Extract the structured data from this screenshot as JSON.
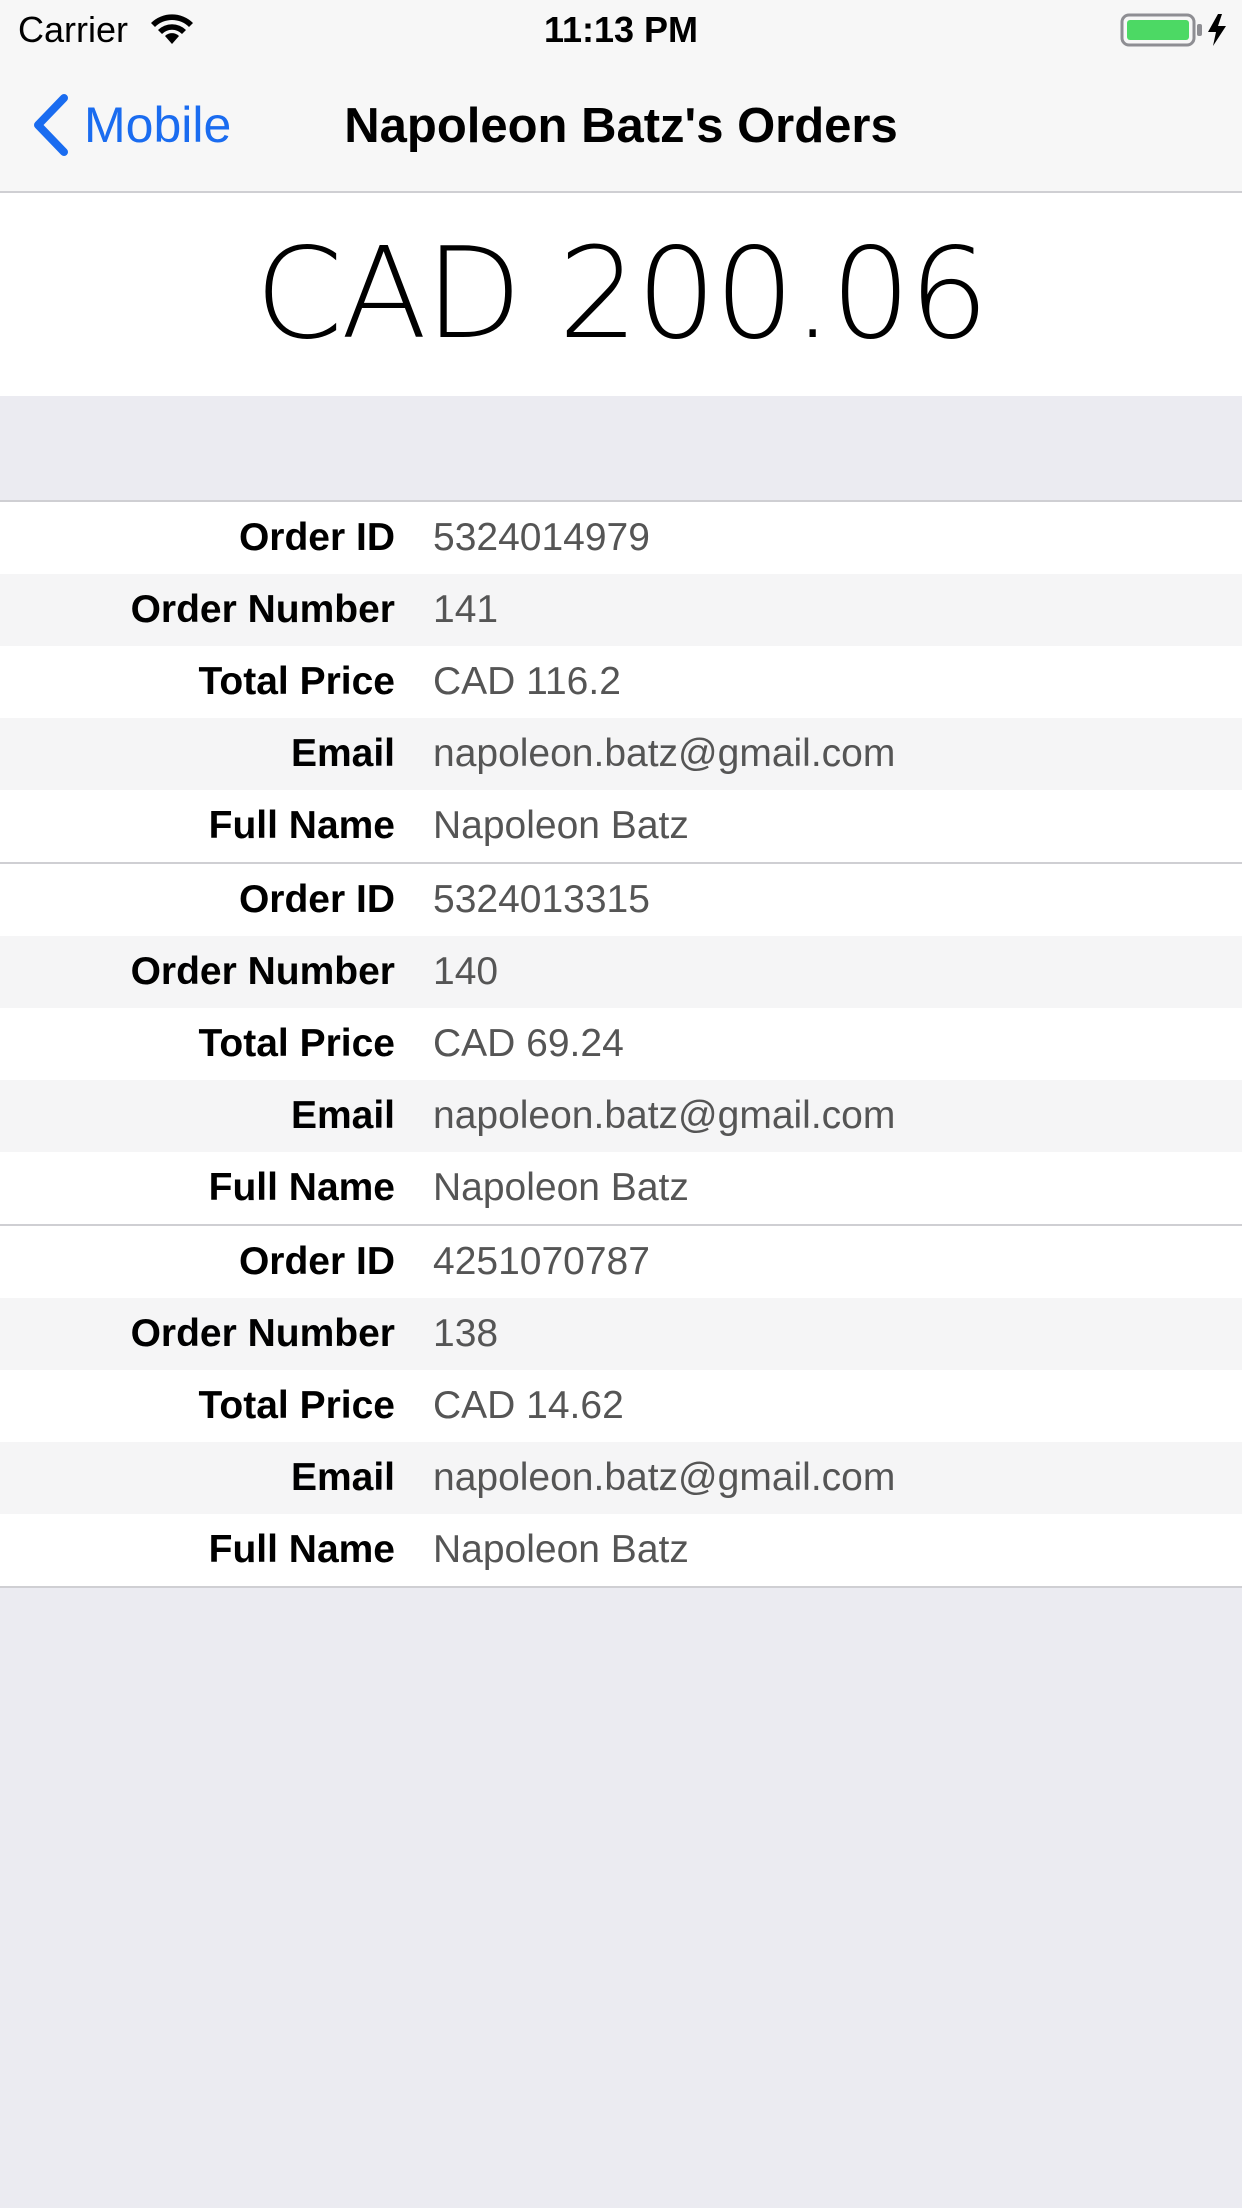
{
  "status_bar": {
    "carrier": "Carrier",
    "time": "11:13 PM",
    "wifi_icon": "wifi-icon",
    "battery_icon": "battery-charging-icon",
    "battery_color": "#4cd964"
  },
  "nav": {
    "back_label": "Mobile",
    "title": "Napoleon Batz's Orders",
    "accent_color": "#1a6cf0"
  },
  "summary": {
    "total": "CAD 200.06"
  },
  "orders": [
    {
      "fields": [
        {
          "label": "Order ID",
          "value": "5324014979"
        },
        {
          "label": "Order Number",
          "value": "141"
        },
        {
          "label": "Total Price",
          "value": "CAD 116.2"
        },
        {
          "label": "Email",
          "value": "napoleon.batz@gmail.com"
        },
        {
          "label": "Full Name",
          "value": "Napoleon Batz"
        }
      ]
    },
    {
      "fields": [
        {
          "label": "Order ID",
          "value": "5324013315"
        },
        {
          "label": "Order Number",
          "value": "140"
        },
        {
          "label": "Total Price",
          "value": "CAD 69.24"
        },
        {
          "label": "Email",
          "value": "napoleon.batz@gmail.com"
        },
        {
          "label": "Full Name",
          "value": "Napoleon Batz"
        }
      ]
    },
    {
      "fields": [
        {
          "label": "Order ID",
          "value": "4251070787"
        },
        {
          "label": "Order Number",
          "value": "138"
        },
        {
          "label": "Total Price",
          "value": "CAD 14.62"
        },
        {
          "label": "Email",
          "value": "napoleon.batz@gmail.com"
        },
        {
          "label": "Full Name",
          "value": "Napoleon Batz"
        }
      ]
    }
  ]
}
